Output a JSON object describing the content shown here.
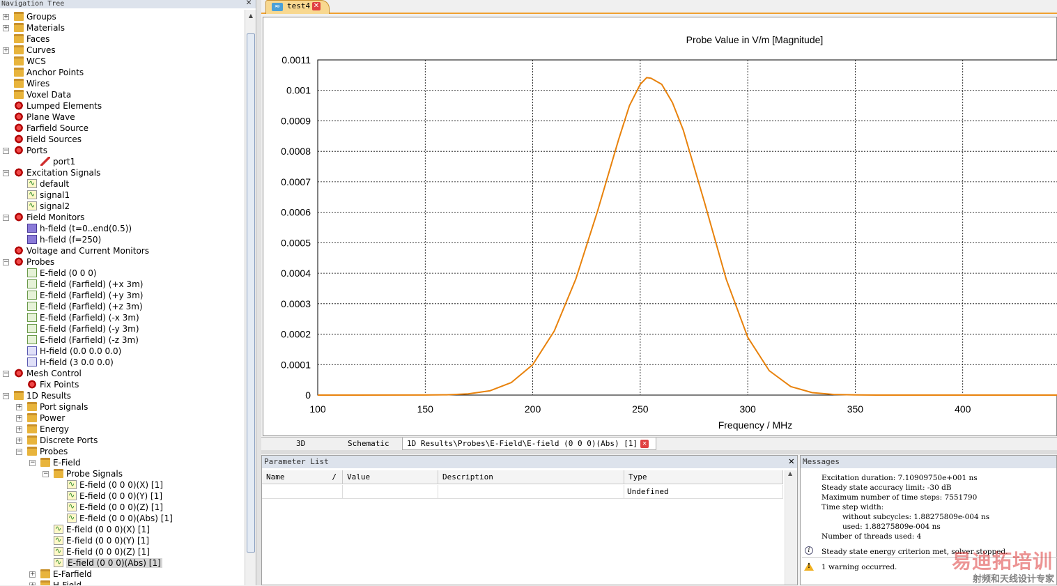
{
  "nav": {
    "title": "Navigation Tree",
    "items": [
      {
        "label": "Groups",
        "icon": "folder-icon",
        "level": 0,
        "expander": "+"
      },
      {
        "label": "Materials",
        "icon": "folder-icon",
        "level": 0,
        "expander": "+"
      },
      {
        "label": "Faces",
        "icon": "folder-icon",
        "level": 0,
        "expander": ""
      },
      {
        "label": "Curves",
        "icon": "folder-icon",
        "level": 0,
        "expander": "+"
      },
      {
        "label": "WCS",
        "icon": "folder-icon",
        "level": 0,
        "expander": ""
      },
      {
        "label": "Anchor Points",
        "icon": "folder-icon",
        "level": 0,
        "expander": ""
      },
      {
        "label": "Wires",
        "icon": "folder-icon",
        "level": 0,
        "expander": ""
      },
      {
        "label": "Voxel Data",
        "icon": "folder-icon",
        "level": 0,
        "expander": ""
      },
      {
        "label": "Lumped Elements",
        "icon": "gear-icon",
        "level": 0,
        "expander": ""
      },
      {
        "label": "Plane Wave",
        "icon": "gear-icon",
        "level": 0,
        "expander": ""
      },
      {
        "label": "Farfield Source",
        "icon": "gear-icon",
        "level": 0,
        "expander": ""
      },
      {
        "label": "Field Sources",
        "icon": "gear-icon",
        "level": 0,
        "expander": ""
      },
      {
        "label": "Ports",
        "icon": "gear-icon",
        "level": 0,
        "expander": "-"
      },
      {
        "label": "port1",
        "icon": "port-icon",
        "level": 2,
        "expander": ""
      },
      {
        "label": "Excitation Signals",
        "icon": "gear-icon",
        "level": 0,
        "expander": "-"
      },
      {
        "label": "default",
        "icon": "signal-icon",
        "level": 1,
        "expander": ""
      },
      {
        "label": "signal1",
        "icon": "signal-icon",
        "level": 1,
        "expander": ""
      },
      {
        "label": "signal2",
        "icon": "signal-icon",
        "level": 1,
        "expander": ""
      },
      {
        "label": "Field Monitors",
        "icon": "gear-icon",
        "level": 0,
        "expander": "-"
      },
      {
        "label": "h-field (t=0..end(0.5))",
        "icon": "monitor-icon",
        "level": 1,
        "expander": ""
      },
      {
        "label": "h-field (f=250)",
        "icon": "monitor-icon",
        "level": 1,
        "expander": ""
      },
      {
        "label": "Voltage and Current Monitors",
        "icon": "gear-icon",
        "level": 0,
        "expander": ""
      },
      {
        "label": "Probes",
        "icon": "gear-icon",
        "level": 0,
        "expander": "-"
      },
      {
        "label": "E-field (0 0 0)",
        "icon": "probe-icon",
        "level": 1,
        "expander": ""
      },
      {
        "label": "E-field (Farfield) (+x 3m)",
        "icon": "probe-icon",
        "level": 1,
        "expander": ""
      },
      {
        "label": "E-field (Farfield) (+y 3m)",
        "icon": "probe-icon",
        "level": 1,
        "expander": ""
      },
      {
        "label": "E-field (Farfield) (+z 3m)",
        "icon": "probe-icon",
        "level": 1,
        "expander": ""
      },
      {
        "label": "E-field (Farfield) (-x 3m)",
        "icon": "probe-icon",
        "level": 1,
        "expander": ""
      },
      {
        "label": "E-field (Farfield) (-y 3m)",
        "icon": "probe-icon",
        "level": 1,
        "expander": ""
      },
      {
        "label": "E-field (Farfield) (-z 3m)",
        "icon": "probe-icon",
        "level": 1,
        "expander": ""
      },
      {
        "label": "H-field (0.0 0.0 0.0)",
        "icon": "hprobe-icon",
        "level": 1,
        "expander": ""
      },
      {
        "label": "H-field (3 0.0 0.0)",
        "icon": "hprobe-icon",
        "level": 1,
        "expander": ""
      },
      {
        "label": "Mesh Control",
        "icon": "gear-icon",
        "level": 0,
        "expander": "-"
      },
      {
        "label": "Fix Points",
        "icon": "gear-icon",
        "level": 1,
        "expander": ""
      },
      {
        "label": "1D Results",
        "icon": "folder-icon",
        "level": 0,
        "expander": "-"
      },
      {
        "label": "Port signals",
        "icon": "folder-icon",
        "level": 1,
        "expander": "+"
      },
      {
        "label": "Power",
        "icon": "folder-icon",
        "level": 1,
        "expander": "+"
      },
      {
        "label": "Energy",
        "icon": "folder-icon",
        "level": 1,
        "expander": "+"
      },
      {
        "label": "Discrete Ports",
        "icon": "folder-icon",
        "level": 1,
        "expander": "+"
      },
      {
        "label": "Probes",
        "icon": "folder-icon",
        "level": 1,
        "expander": "-"
      },
      {
        "label": "E-Field",
        "icon": "folder-icon",
        "level": 2,
        "expander": "-"
      },
      {
        "label": "Probe Signals",
        "icon": "folder-icon",
        "level": 3,
        "expander": "-"
      },
      {
        "label": "E-field (0 0 0)(X) [1]",
        "icon": "signal-icon",
        "level": 4,
        "expander": ""
      },
      {
        "label": "E-field (0 0 0)(Y) [1]",
        "icon": "signal-icon",
        "level": 4,
        "expander": ""
      },
      {
        "label": "E-field (0 0 0)(Z) [1]",
        "icon": "signal-icon",
        "level": 4,
        "expander": ""
      },
      {
        "label": "E-field (0 0 0)(Abs) [1]",
        "icon": "signal-icon",
        "level": 4,
        "expander": ""
      },
      {
        "label": "E-field (0 0 0)(X) [1]",
        "icon": "signal-icon",
        "level": 3,
        "expander": ""
      },
      {
        "label": "E-field (0 0 0)(Y) [1]",
        "icon": "signal-icon",
        "level": 3,
        "expander": ""
      },
      {
        "label": "E-field (0 0 0)(Z) [1]",
        "icon": "signal-icon",
        "level": 3,
        "expander": ""
      },
      {
        "label": "E-field (0 0 0)(Abs) [1]",
        "icon": "signal-icon",
        "level": 3,
        "expander": "",
        "selected": true
      },
      {
        "label": "E-Farfield",
        "icon": "folder-icon",
        "level": 2,
        "expander": "+"
      },
      {
        "label": "H-Field",
        "icon": "folder-icon",
        "level": 2,
        "expander": "+"
      }
    ]
  },
  "tabs": {
    "active": "test4"
  },
  "chart_data": {
    "type": "line",
    "title": "Probe Value in V/m [Magnitude]",
    "xlabel": "Frequency / MHz",
    "ylabel": "",
    "xlim": [
      100,
      450
    ],
    "ylim": [
      0,
      0.0011
    ],
    "xticks": [
      "100",
      "150",
      "200",
      "250",
      "300",
      "350",
      "400"
    ],
    "yticks": [
      "0",
      "0.0001",
      "0.0002",
      "0.0003",
      "0.0004",
      "0.0005",
      "0.0006",
      "0.0007",
      "0.0008",
      "0.0009",
      "0.001",
      "0.0011"
    ],
    "grid": true,
    "color": "#e8820c",
    "series": [
      {
        "x": [
          100,
          150,
          160,
          170,
          180,
          190,
          200,
          210,
          220,
          230,
          240,
          245,
          250,
          253,
          255,
          260,
          265,
          270,
          280,
          290,
          300,
          310,
          320,
          330,
          340,
          350,
          360,
          400,
          450
        ],
        "y": [
          0,
          3e-07,
          1e-06,
          4e-06,
          1.4e-05,
          4.1e-05,
          0.0001,
          0.00021,
          0.00038,
          0.0006,
          0.00084,
          0.00095,
          0.00102,
          0.001042,
          0.00104,
          0.00102,
          0.00096,
          0.00087,
          0.00063,
          0.00038,
          0.00019,
          8e-05,
          2.8e-05,
          8e-06,
          2e-06,
          4e-07,
          0,
          0,
          0
        ]
      }
    ]
  },
  "viewtabs": {
    "t3d": "3D",
    "schematic": "Schematic",
    "result": "1D Results\\Probes\\E-Field\\E-field (0 0 0)(Abs) [1]"
  },
  "param": {
    "title": "Parameter List",
    "headers": {
      "name": "Name",
      "sort": "/",
      "value": "Value",
      "desc": "Description",
      "type": "Type"
    },
    "row": {
      "name": "",
      "value": "",
      "desc": "",
      "type": "Undefined"
    }
  },
  "messages": {
    "title": "Messages",
    "lines": [
      "Excitation duration: 7.10909750e+001 ns",
      "Steady state accuracy limit: -30 dB",
      "Maximum number of time steps: 7551790",
      "Time step width:",
      "without subcycles: 1.88275809e-004 ns",
      "used: 1.88275809e-004 ns",
      "Number of threads used: 4"
    ],
    "info": "Steady state energy criterion met, solver stopped.",
    "warning": "1 warning occurred."
  },
  "watermark": {
    "big": "易迪拓培训",
    "small": "射频和天线设计专家"
  }
}
